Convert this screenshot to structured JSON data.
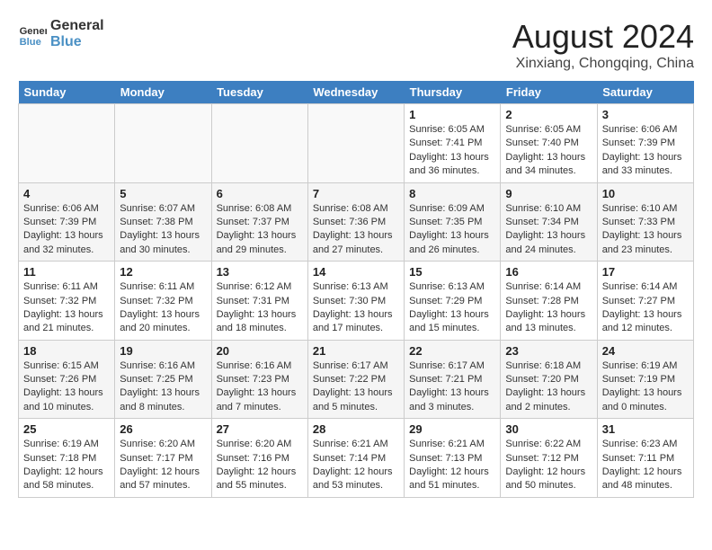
{
  "header": {
    "logo_line1": "General",
    "logo_line2": "Blue",
    "month_year": "August 2024",
    "location": "Xinxiang, Chongqing, China"
  },
  "days_of_week": [
    "Sunday",
    "Monday",
    "Tuesday",
    "Wednesday",
    "Thursday",
    "Friday",
    "Saturday"
  ],
  "weeks": [
    [
      {
        "day": "",
        "info": ""
      },
      {
        "day": "",
        "info": ""
      },
      {
        "day": "",
        "info": ""
      },
      {
        "day": "",
        "info": ""
      },
      {
        "day": "1",
        "info": "Sunrise: 6:05 AM\nSunset: 7:41 PM\nDaylight: 13 hours\nand 36 minutes."
      },
      {
        "day": "2",
        "info": "Sunrise: 6:05 AM\nSunset: 7:40 PM\nDaylight: 13 hours\nand 34 minutes."
      },
      {
        "day": "3",
        "info": "Sunrise: 6:06 AM\nSunset: 7:39 PM\nDaylight: 13 hours\nand 33 minutes."
      }
    ],
    [
      {
        "day": "4",
        "info": "Sunrise: 6:06 AM\nSunset: 7:39 PM\nDaylight: 13 hours\nand 32 minutes."
      },
      {
        "day": "5",
        "info": "Sunrise: 6:07 AM\nSunset: 7:38 PM\nDaylight: 13 hours\nand 30 minutes."
      },
      {
        "day": "6",
        "info": "Sunrise: 6:08 AM\nSunset: 7:37 PM\nDaylight: 13 hours\nand 29 minutes."
      },
      {
        "day": "7",
        "info": "Sunrise: 6:08 AM\nSunset: 7:36 PM\nDaylight: 13 hours\nand 27 minutes."
      },
      {
        "day": "8",
        "info": "Sunrise: 6:09 AM\nSunset: 7:35 PM\nDaylight: 13 hours\nand 26 minutes."
      },
      {
        "day": "9",
        "info": "Sunrise: 6:10 AM\nSunset: 7:34 PM\nDaylight: 13 hours\nand 24 minutes."
      },
      {
        "day": "10",
        "info": "Sunrise: 6:10 AM\nSunset: 7:33 PM\nDaylight: 13 hours\nand 23 minutes."
      }
    ],
    [
      {
        "day": "11",
        "info": "Sunrise: 6:11 AM\nSunset: 7:32 PM\nDaylight: 13 hours\nand 21 minutes."
      },
      {
        "day": "12",
        "info": "Sunrise: 6:11 AM\nSunset: 7:32 PM\nDaylight: 13 hours\nand 20 minutes."
      },
      {
        "day": "13",
        "info": "Sunrise: 6:12 AM\nSunset: 7:31 PM\nDaylight: 13 hours\nand 18 minutes."
      },
      {
        "day": "14",
        "info": "Sunrise: 6:13 AM\nSunset: 7:30 PM\nDaylight: 13 hours\nand 17 minutes."
      },
      {
        "day": "15",
        "info": "Sunrise: 6:13 AM\nSunset: 7:29 PM\nDaylight: 13 hours\nand 15 minutes."
      },
      {
        "day": "16",
        "info": "Sunrise: 6:14 AM\nSunset: 7:28 PM\nDaylight: 13 hours\nand 13 minutes."
      },
      {
        "day": "17",
        "info": "Sunrise: 6:14 AM\nSunset: 7:27 PM\nDaylight: 13 hours\nand 12 minutes."
      }
    ],
    [
      {
        "day": "18",
        "info": "Sunrise: 6:15 AM\nSunset: 7:26 PM\nDaylight: 13 hours\nand 10 minutes."
      },
      {
        "day": "19",
        "info": "Sunrise: 6:16 AM\nSunset: 7:25 PM\nDaylight: 13 hours\nand 8 minutes."
      },
      {
        "day": "20",
        "info": "Sunrise: 6:16 AM\nSunset: 7:23 PM\nDaylight: 13 hours\nand 7 minutes."
      },
      {
        "day": "21",
        "info": "Sunrise: 6:17 AM\nSunset: 7:22 PM\nDaylight: 13 hours\nand 5 minutes."
      },
      {
        "day": "22",
        "info": "Sunrise: 6:17 AM\nSunset: 7:21 PM\nDaylight: 13 hours\nand 3 minutes."
      },
      {
        "day": "23",
        "info": "Sunrise: 6:18 AM\nSunset: 7:20 PM\nDaylight: 13 hours\nand 2 minutes."
      },
      {
        "day": "24",
        "info": "Sunrise: 6:19 AM\nSunset: 7:19 PM\nDaylight: 13 hours\nand 0 minutes."
      }
    ],
    [
      {
        "day": "25",
        "info": "Sunrise: 6:19 AM\nSunset: 7:18 PM\nDaylight: 12 hours\nand 58 minutes."
      },
      {
        "day": "26",
        "info": "Sunrise: 6:20 AM\nSunset: 7:17 PM\nDaylight: 12 hours\nand 57 minutes."
      },
      {
        "day": "27",
        "info": "Sunrise: 6:20 AM\nSunset: 7:16 PM\nDaylight: 12 hours\nand 55 minutes."
      },
      {
        "day": "28",
        "info": "Sunrise: 6:21 AM\nSunset: 7:14 PM\nDaylight: 12 hours\nand 53 minutes."
      },
      {
        "day": "29",
        "info": "Sunrise: 6:21 AM\nSunset: 7:13 PM\nDaylight: 12 hours\nand 51 minutes."
      },
      {
        "day": "30",
        "info": "Sunrise: 6:22 AM\nSunset: 7:12 PM\nDaylight: 12 hours\nand 50 minutes."
      },
      {
        "day": "31",
        "info": "Sunrise: 6:23 AM\nSunset: 7:11 PM\nDaylight: 12 hours\nand 48 minutes."
      }
    ]
  ]
}
